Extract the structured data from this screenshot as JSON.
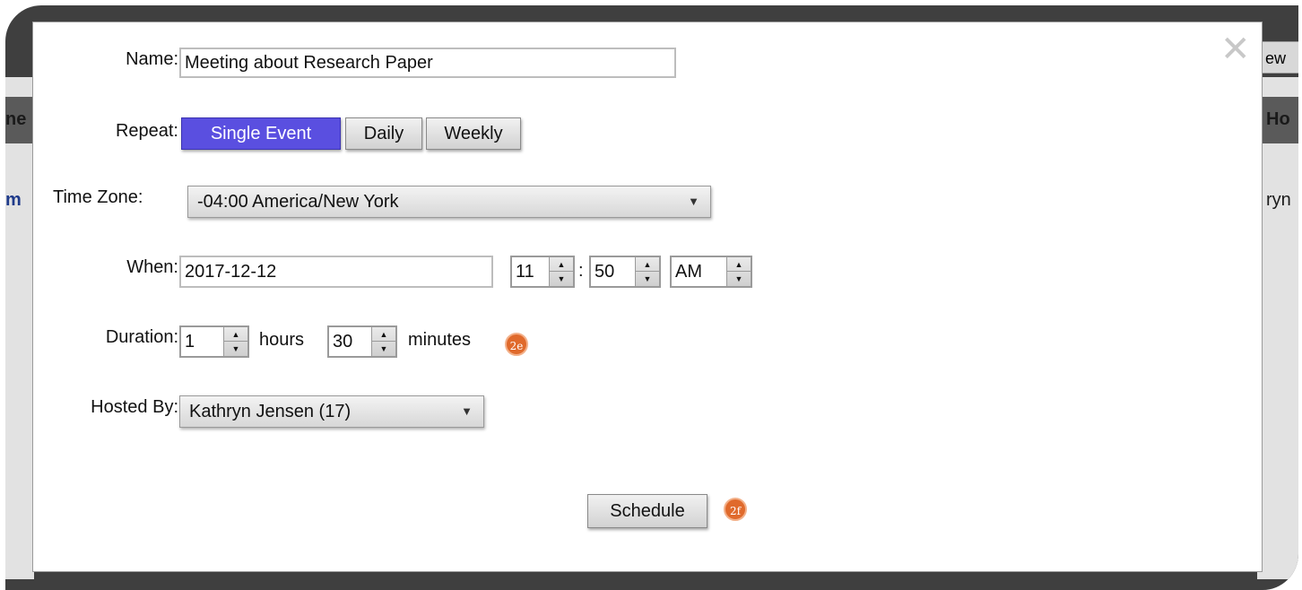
{
  "background": {
    "left_header_fragment": "ne",
    "right_header_fragment": "Ho",
    "left_link_fragment": "m",
    "right_link_fragment": "ryn",
    "view_button_fragment": "ew"
  },
  "modal": {
    "close_glyph": "✕",
    "name": {
      "label": "Name:",
      "value": "Meeting about Research Paper"
    },
    "repeat": {
      "label": "Repeat:",
      "options": [
        "Single Event",
        "Daily",
        "Weekly"
      ],
      "selected": "Single Event"
    },
    "time_zone": {
      "label": "Time Zone:",
      "value": "-04:00 America/New York"
    },
    "when": {
      "label": "When:",
      "date": "2017-12-12",
      "hour": "11",
      "minute": "50",
      "ampm": "AM",
      "separator": ":"
    },
    "duration": {
      "label": "Duration:",
      "hours": "1",
      "hours_unit": "hours",
      "minutes": "30",
      "minutes_unit": "minutes"
    },
    "hosted_by": {
      "label": "Hosted By:",
      "value": "Kathryn Jensen (17)"
    },
    "schedule_button": "Schedule"
  },
  "annotations": {
    "badge_duration": "2e",
    "badge_schedule": "2f"
  },
  "colors": {
    "accent": "#5a4fe0",
    "badge": "#e06a2c",
    "frame": "#3f3f3f"
  },
  "icons": {
    "close": "close-icon",
    "dropdown": "chevron-down-icon",
    "spinner_up": "caret-up-icon",
    "spinner_down": "caret-down-icon"
  }
}
